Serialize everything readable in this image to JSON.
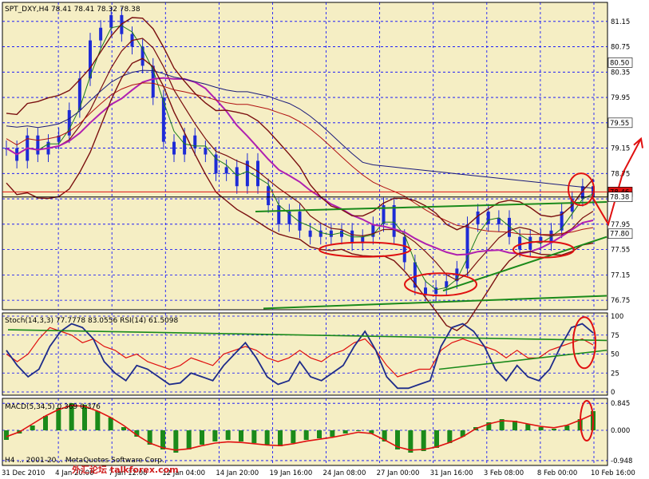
{
  "colors": {
    "background": "#f5eec4",
    "frame": "#000000",
    "grid": "#0000ff",
    "candle": "#1e2bd6",
    "bollinger": "#7a0f0f",
    "ma_purple": "#b020b0",
    "ma_red": "#b01010",
    "ma_navy": "#1a1a7a",
    "ma_green": "#1a7a1a",
    "trend_green": "#1a8a1a",
    "annot_red": "#e01010",
    "stoch_main": "#1e2b8a",
    "stoch_signal": "#e01010",
    "macd_hist": "#1a8a1a",
    "macd_signal": "#e01010"
  },
  "header": {
    "main_title": "SPT_DXY,H4  78.41 78.41 78.32 78.38",
    "stoch_title": "Stoch(14,3,3) 77.7778 83.0556 RSI(14) 61.5098",
    "macd_title": "MACD(5,34,5) 0.369 0.376",
    "copyright": "H4 ... 2001-20... MetaQuotes Software Corp.",
    "watermark": "外汇论坛 talkforex.com"
  },
  "chart_data": [
    {
      "type": "candlestick",
      "title": "SPT_DXY,H4",
      "ohlc_last": {
        "open": 78.41,
        "high": 78.41,
        "low": 78.32,
        "close": 78.38
      },
      "ylim": [
        76.6,
        81.45
      ],
      "y_ticks": [
        81.15,
        80.75,
        80.35,
        79.95,
        79.55,
        79.15,
        78.75,
        78.35,
        77.95,
        77.55,
        77.15,
        76.75
      ],
      "highlight_labels": [
        {
          "text": "80.50",
          "value": 80.5
        },
        {
          "text": "79.55",
          "value": 79.55
        },
        {
          "text": "78.46",
          "value": 78.46
        },
        {
          "text": "78.38",
          "value": 78.38
        },
        {
          "text": "77.80",
          "value": 77.8
        }
      ],
      "x_labels": [
        "31 Dec 2010",
        "4 Jan 20:00",
        "7 Jan 12:00",
        "12 Jan 04:00",
        "14 Jan 20:00",
        "19 Jan 16:00",
        "24 Jan 08:00",
        "27 Jan 00:00",
        "31 Jan 16:00",
        "3 Feb 08:00",
        "8 Feb 00:00",
        "10 Feb 16:00"
      ],
      "close_path": [
        79.15,
        78.95,
        79.35,
        79.05,
        79.25,
        79.35,
        79.75,
        80.25,
        80.85,
        81.05,
        81.25,
        80.95,
        80.75,
        80.45,
        79.95,
        79.25,
        79.05,
        79.35,
        79.15,
        79.05,
        78.75,
        78.85,
        78.55,
        78.95,
        78.55,
        78.25,
        77.95,
        78.15,
        77.85,
        77.75,
        77.85,
        77.75,
        77.85,
        77.65,
        77.75,
        77.95,
        78.25,
        77.75,
        77.35,
        76.95,
        76.85,
        76.95,
        77.05,
        77.25,
        77.95,
        78.15,
        77.95,
        78.05,
        77.75,
        77.55,
        77.75,
        77.65,
        77.85,
        78.15,
        78.35,
        78.55,
        78.38
      ]
    },
    {
      "type": "line",
      "title": "Stoch(14,3,3)",
      "ylim": [
        0,
        100
      ],
      "y_ticks": [
        100,
        75,
        50,
        25,
        0
      ],
      "main": [
        55,
        35,
        20,
        30,
        60,
        80,
        90,
        85,
        70,
        40,
        25,
        15,
        35,
        30,
        20,
        10,
        12,
        25,
        20,
        15,
        35,
        50,
        65,
        45,
        20,
        10,
        15,
        40,
        20,
        15,
        25,
        35,
        60,
        80,
        55,
        20,
        5,
        5,
        10,
        15,
        60,
        85,
        90,
        80,
        60,
        30,
        15,
        35,
        20,
        15,
        30,
        60,
        85,
        90,
        78
      ],
      "signal": [
        50,
        40,
        50,
        70,
        85,
        80,
        75,
        65,
        70,
        60,
        55,
        45,
        50,
        40,
        35,
        30,
        35,
        45,
        40,
        35,
        50,
        55,
        60,
        55,
        45,
        40,
        45,
        55,
        45,
        40,
        50,
        55,
        65,
        70,
        55,
        35,
        20,
        25,
        30,
        30,
        55,
        65,
        70,
        65,
        60,
        55,
        45,
        55,
        45,
        45,
        55,
        60,
        65,
        70,
        62
      ]
    },
    {
      "type": "bar",
      "title": "MACD(5,34,5)",
      "ylim": [
        -1.1,
        1.0
      ],
      "y_ticks": [
        0.845,
        0.0,
        -0.948
      ],
      "histogram": [
        -0.3,
        -0.1,
        0.15,
        0.45,
        0.7,
        0.85,
        0.8,
        0.6,
        0.4,
        0.1,
        -0.2,
        -0.45,
        -0.6,
        -0.7,
        -0.6,
        -0.45,
        -0.35,
        -0.3,
        -0.35,
        -0.4,
        -0.45,
        -0.5,
        -0.4,
        -0.3,
        -0.25,
        -0.2,
        -0.1,
        0.0,
        -0.1,
        -0.35,
        -0.6,
        -0.7,
        -0.65,
        -0.55,
        -0.4,
        -0.2,
        0.1,
        0.25,
        0.35,
        0.3,
        0.2,
        0.1,
        0.05,
        0.15,
        0.35,
        0.6
      ],
      "signal": [
        -0.2,
        -0.05,
        0.2,
        0.45,
        0.65,
        0.78,
        0.75,
        0.6,
        0.4,
        0.15,
        -0.15,
        -0.4,
        -0.55,
        -0.62,
        -0.58,
        -0.48,
        -0.4,
        -0.36,
        -0.38,
        -0.42,
        -0.46,
        -0.48,
        -0.42,
        -0.34,
        -0.28,
        -0.22,
        -0.14,
        -0.06,
        -0.1,
        -0.3,
        -0.52,
        -0.62,
        -0.6,
        -0.52,
        -0.38,
        -0.2,
        0.05,
        0.2,
        0.3,
        0.28,
        0.2,
        0.12,
        0.08,
        0.16,
        0.32,
        0.5
      ]
    }
  ]
}
